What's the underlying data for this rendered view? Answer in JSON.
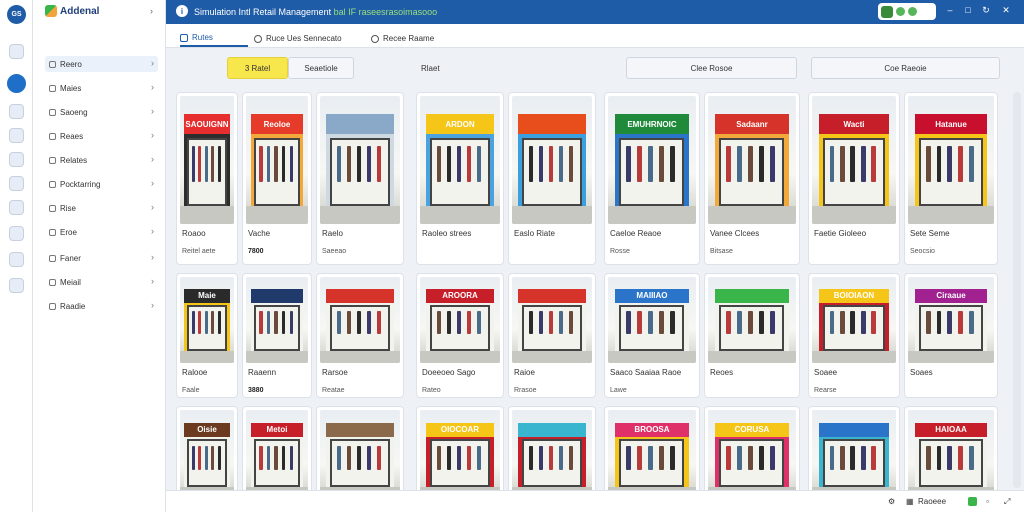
{
  "app": {
    "title_main": "Simulation Intl Retail Management",
    "title_highlight": "bal IF",
    "title_tail": "raseesrasoimasooo"
  },
  "rail": {
    "logo": "GS",
    "icons": [
      "home-icon",
      "shop-icon",
      "info-icon",
      "chart-icon",
      "document-icon",
      "pen-icon",
      "building-icon",
      "map-icon",
      "settings-icon"
    ]
  },
  "nav": {
    "brand": "Addenal",
    "items": [
      {
        "label": "Reero",
        "icon": "grid-icon"
      },
      {
        "label": "Maies",
        "icon": "box-icon"
      },
      {
        "label": "Saoeng",
        "icon": "tag-icon"
      },
      {
        "label": "Reaes",
        "icon": "chart-icon"
      },
      {
        "label": "Relates",
        "icon": "link-icon"
      },
      {
        "label": "Pocktarring",
        "icon": "document-icon"
      },
      {
        "label": "Rise",
        "icon": "pen-icon"
      },
      {
        "label": "Eroe",
        "icon": "building-icon"
      },
      {
        "label": "Faner",
        "icon": "money-icon"
      },
      {
        "label": "Meiail",
        "icon": "mail-icon"
      },
      {
        "label": "Raadie",
        "icon": "settings-icon"
      }
    ]
  },
  "tabs": [
    {
      "label": "Rutes",
      "icon": "store-icon"
    },
    {
      "label": "Ruce Ues Sennecato",
      "icon": "circle-icon"
    },
    {
      "label": "Recee Raame",
      "icon": "circle-icon"
    }
  ],
  "toolbar": {
    "btn1": "3 Ratel",
    "btn2": "Seaetiole",
    "label": "Rlaet",
    "btn3": "Clee Rosoe",
    "btn4": "Coe Raeoie"
  },
  "rows": [
    [
      {
        "name": "Roaoo",
        "meta": "Reitel aete",
        "sign": "SAOUIGNN"
      },
      {
        "name": "Vache",
        "meta": "7800",
        "sign": "Reoloe"
      },
      {
        "name": "Raelo",
        "meta": "Saeeao",
        "sign": ""
      },
      {
        "name": "Raoleo strees",
        "meta": "",
        "sign": "ARDON"
      },
      {
        "name": "Easlo Riate",
        "meta": "",
        "sign": ""
      },
      {
        "name": "Caeloe Reaoe",
        "meta": "Rosse",
        "sign": "EMUHRNOIC"
      },
      {
        "name": "Vanee Clcees",
        "meta": "Bitsase",
        "sign": "Sadaanr"
      },
      {
        "name": "Faetie Gioleeo",
        "meta": "",
        "sign": "Wacti"
      },
      {
        "name": "Sete Seme",
        "meta": "Seocsio",
        "sign": "Hatanue"
      }
    ],
    [
      {
        "name": "Ralooe",
        "meta": "Faale",
        "sign": "Maie"
      },
      {
        "name": "Raaenn",
        "meta": "3880",
        "sign": ""
      },
      {
        "name": "Rarsoe",
        "meta": "Reatae",
        "sign": ""
      },
      {
        "name": "Doeeoeo Sago",
        "meta": "Rateo",
        "sign": "AROORA"
      },
      {
        "name": "Raioe",
        "meta": "Rrasoe",
        "sign": ""
      },
      {
        "name": "Saaco Saaiaa Raoe",
        "meta": "Lawe",
        "sign": "MAIIIAO"
      },
      {
        "name": "Reoes",
        "meta": "",
        "sign": ""
      },
      {
        "name": "Soaee",
        "meta": "Rearse",
        "sign": "BOIOIAON"
      },
      {
        "name": "Soaes",
        "meta": "",
        "sign": "Ciraaue"
      }
    ],
    [
      {
        "name": "",
        "meta": "",
        "sign": "Oisie"
      },
      {
        "name": "",
        "meta": "",
        "sign": "Metoi"
      },
      {
        "name": "",
        "meta": "",
        "sign": ""
      },
      {
        "name": "",
        "meta": "",
        "sign": "OIOCOAR"
      },
      {
        "name": "",
        "meta": "",
        "sign": ""
      },
      {
        "name": "",
        "meta": "",
        "sign": "BROOSA"
      },
      {
        "name": "",
        "meta": "",
        "sign": "CORUSA"
      },
      {
        "name": "",
        "meta": "",
        "sign": ""
      },
      {
        "name": "",
        "meta": "",
        "sign": "HAIOAA"
      }
    ]
  ],
  "status": {
    "left": "Raoeee",
    "right": ""
  },
  "colors": {
    "primary": "#1f5ca8",
    "accent_yellow": "#f7e64c",
    "green": "#3ab54a"
  }
}
